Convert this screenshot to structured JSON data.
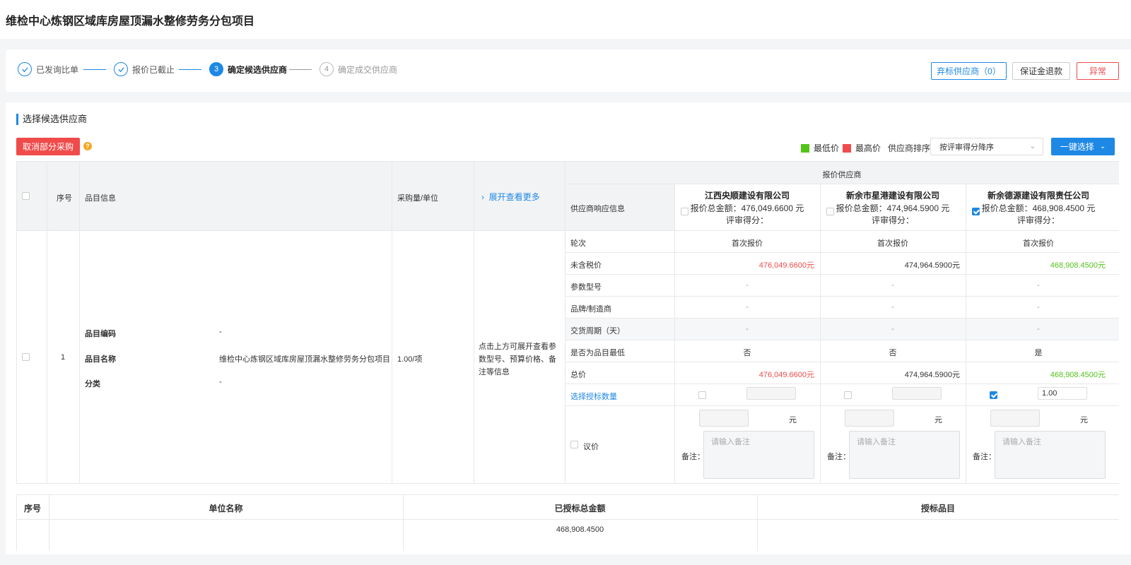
{
  "page": {
    "title": "维检中心炼钢区域库房屋顶漏水整修劳务分包项目"
  },
  "steps": [
    {
      "num": "1",
      "label": "已发询比单",
      "state": "done"
    },
    {
      "num": "2",
      "label": "报价已截止",
      "state": "done"
    },
    {
      "num": "3",
      "label": "确定候选供应商",
      "state": "active"
    },
    {
      "num": "4",
      "label": "确定成交供应商",
      "state": "todo"
    }
  ],
  "header_buttons": {
    "abandon": "弃标供应商（0）",
    "deposit": "保证金退款",
    "abnormal": "异常"
  },
  "section": {
    "title": "选择候选供应商"
  },
  "toolbar": {
    "cancel_part": "取消部分采购",
    "help": "?",
    "legend_low": "最低价",
    "legend_high": "最高价",
    "sort_label": "供应商排序",
    "sort_value": "按评审得分降序",
    "one_click": "一键选择"
  },
  "colors": {
    "low": "#52c41a",
    "high": "#f04b4b",
    "accent": "#1e88e5"
  },
  "table": {
    "headers": {
      "index": "序号",
      "item_info": "品目信息",
      "qty_unit": "采购量/单位",
      "expand": "展开查看更多",
      "quoted_suppliers": "报价供应商",
      "response_info": "供应商响应信息"
    },
    "suppliers": [
      {
        "name": "江西央顺建设有限公司",
        "total": "报价总金额：476,049.6600 元",
        "score": "评审得分：",
        "checked": false
      },
      {
        "name": "新余市星港建设有限公司",
        "total": "报价总金额：474,964.5900 元",
        "score": "评审得分：",
        "checked": false
      },
      {
        "name": "新余德源建设有限责任公司",
        "total": "报价总金额：468,908.4500 元",
        "score": "评审得分：",
        "checked": true
      }
    ],
    "row": {
      "index": "1",
      "code_label": "品目编码",
      "code_value": "-",
      "name_label": "品目名称",
      "name_value": "维检中心炼钢区域库房屋顶漏水整修劳务分包项目",
      "category_label": "分类",
      "category_value": "-",
      "qty": "1.00/项",
      "expand_hint": "点击上方可展开查看参数型号、预算价格、备注等信息"
    },
    "attr_labels": [
      "轮次",
      "未含税价",
      "参数型号",
      "品牌/制造商",
      "交货周期（天）",
      "是否为品目最低",
      "总价",
      "选择授标数量",
      "议价"
    ],
    "values": [
      [
        "首次报价",
        "476,049.6600元",
        "-",
        "-",
        "-",
        "否",
        "476,049.6600元"
      ],
      [
        "首次报价",
        "474,964.5900元",
        "-",
        "-",
        "-",
        "否",
        "474,964.5900元"
      ],
      [
        "首次报价",
        "468,908.4500元",
        "-",
        "-",
        "-",
        "是",
        "468,908.4500元"
      ]
    ],
    "award_qty": [
      "",
      "",
      "1.00"
    ],
    "award_checked": [
      false,
      false,
      true
    ],
    "unit_yuan": "元",
    "remark_label": "备注：",
    "remark_placeholder": "请输入备注"
  },
  "bottom_table": {
    "headers": [
      "序号",
      "单位名称",
      "已授标总金额",
      "授标品目"
    ],
    "first_amount": "468,908.4500"
  }
}
